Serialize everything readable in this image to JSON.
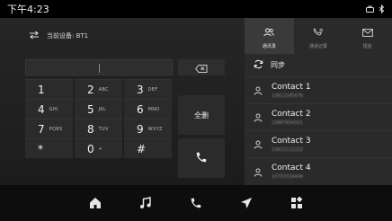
{
  "status": {
    "time": "下午4:23",
    "icons": [
      "sim-icon",
      "bluetooth-icon"
    ]
  },
  "dialer": {
    "bt_label": "当前设备: BT1",
    "input_value": "",
    "clear_all_label": "全删",
    "keys": [
      {
        "digit": "1",
        "letters": ""
      },
      {
        "digit": "2",
        "letters": "ABC"
      },
      {
        "digit": "3",
        "letters": "DEF"
      },
      {
        "digit": "4",
        "letters": "GHI"
      },
      {
        "digit": "5",
        "letters": "JKL"
      },
      {
        "digit": "6",
        "letters": "MNO"
      },
      {
        "digit": "7",
        "letters": "PQRS"
      },
      {
        "digit": "8",
        "letters": "TUV"
      },
      {
        "digit": "9",
        "letters": "WXYZ"
      },
      {
        "digit": "*",
        "letters": ""
      },
      {
        "digit": "0",
        "letters": "+"
      },
      {
        "digit": "#",
        "letters": ""
      }
    ]
  },
  "tabs": [
    {
      "label": "通讯录",
      "icon": "contacts-icon",
      "active": true
    },
    {
      "label": "通话记录",
      "icon": "call-log-icon",
      "active": false
    },
    {
      "label": "短信",
      "icon": "message-icon",
      "active": false
    }
  ],
  "sync_label": "同步",
  "contacts": [
    {
      "name": "Contact 1",
      "number": "13812345678"
    },
    {
      "name": "Contact 2",
      "number": "13987654321"
    },
    {
      "name": "Contact 3",
      "number": "13611112222"
    },
    {
      "name": "Contact 4",
      "number": "13733334444"
    }
  ],
  "dock": [
    "home-icon",
    "music-icon",
    "phone-icon",
    "navigation-icon",
    "apps-icon"
  ]
}
